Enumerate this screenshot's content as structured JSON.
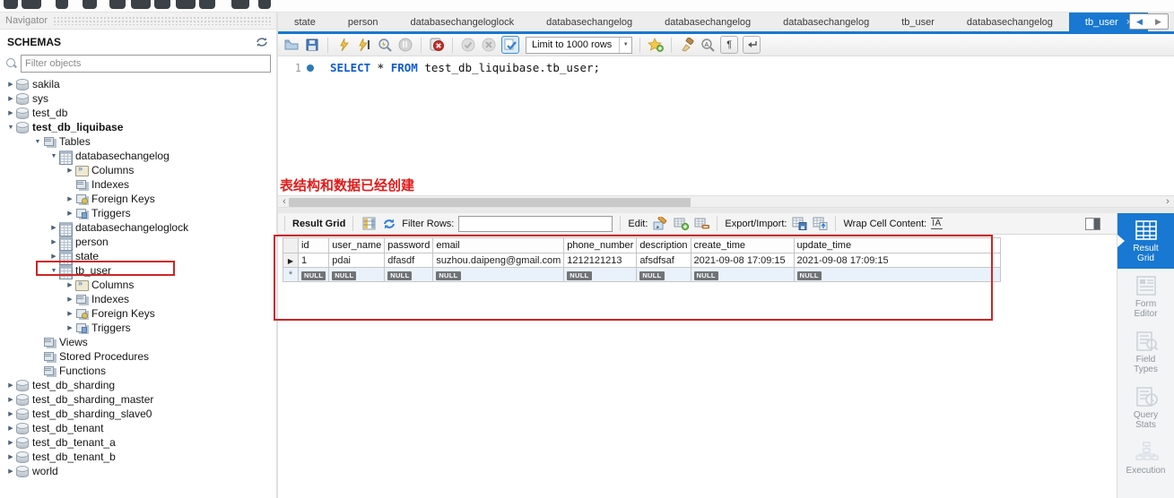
{
  "glyphs": {
    "arrow_right": "▶",
    "arrow_down": "▼",
    "close": "×",
    "caret_down": "▼",
    "scroll_left": "‹",
    "scroll_right": "›",
    "nav_left": "◀",
    "nav_right": "▶",
    "pilcrow": "¶",
    "row_current": "▶",
    "row_new": "*",
    "wrap_cell_icon_text": "ĪA"
  },
  "colors": {
    "accent_blue": "#1878d2",
    "annotation_red": "#e31a1a",
    "null_badge_gray": "#707478",
    "red_annotation_box": "#cf2525"
  },
  "navigator": {
    "title": "Navigator",
    "schemas_header": "SCHEMAS",
    "filter_placeholder": "Filter objects",
    "icons": [
      "refresh-icon",
      "search-icon"
    ],
    "tree": [
      {
        "label": "sakila",
        "icon": "schema-db",
        "arrow": "right",
        "indent": 0
      },
      {
        "label": "sys",
        "icon": "schema-db",
        "arrow": "right",
        "indent": 0
      },
      {
        "label": "test_db",
        "icon": "schema-db",
        "arrow": "right",
        "indent": 0
      },
      {
        "label": "test_db_liquibase",
        "icon": "schema-db",
        "arrow": "down",
        "indent": 0,
        "bold": true
      },
      {
        "label": "Tables",
        "icon": "tables-folder",
        "arrow": "down",
        "indent": 1
      },
      {
        "label": "databasechangelog",
        "icon": "table",
        "arrow": "down",
        "indent": 2
      },
      {
        "label": "Columns",
        "icon": "columns-folder",
        "arrow": "right",
        "indent": 3
      },
      {
        "label": "Indexes",
        "icon": "indexes-folder",
        "arrow": "none",
        "indent": 3
      },
      {
        "label": "Foreign Keys",
        "icon": "foreign-keys-folder",
        "arrow": "right",
        "indent": 3
      },
      {
        "label": "Triggers",
        "icon": "triggers-folder",
        "arrow": "right",
        "indent": 3
      },
      {
        "label": "databasechangeloglock",
        "icon": "table",
        "arrow": "right",
        "indent": 2
      },
      {
        "label": "person",
        "icon": "table",
        "arrow": "right",
        "indent": 2
      },
      {
        "label": "state",
        "icon": "table",
        "arrow": "right",
        "indent": 2
      },
      {
        "label": "tb_user",
        "icon": "table",
        "arrow": "down",
        "indent": 2,
        "highlighted": true
      },
      {
        "label": "Columns",
        "icon": "columns-folder",
        "arrow": "right",
        "indent": 3
      },
      {
        "label": "Indexes",
        "icon": "indexes-folder",
        "arrow": "right",
        "indent": 3
      },
      {
        "label": "Foreign Keys",
        "icon": "foreign-keys-folder",
        "arrow": "right",
        "indent": 3
      },
      {
        "label": "Triggers",
        "icon": "triggers-folder",
        "arrow": "right",
        "indent": 3
      },
      {
        "label": "Views",
        "icon": "views-folder",
        "arrow": "none",
        "indent": 1
      },
      {
        "label": "Stored Procedures",
        "icon": "stored-procedures-folder",
        "arrow": "none",
        "indent": 1
      },
      {
        "label": "Functions",
        "icon": "functions-folder",
        "arrow": "none",
        "indent": 1
      },
      {
        "label": "test_db_sharding",
        "icon": "schema-db",
        "arrow": "right",
        "indent": 0
      },
      {
        "label": "test_db_sharding_master",
        "icon": "schema-db",
        "arrow": "right",
        "indent": 0
      },
      {
        "label": "test_db_sharding_slave0",
        "icon": "schema-db",
        "arrow": "right",
        "indent": 0
      },
      {
        "label": "test_db_tenant",
        "icon": "schema-db",
        "arrow": "right",
        "indent": 0
      },
      {
        "label": "test_db_tenant_a",
        "icon": "schema-db",
        "arrow": "right",
        "indent": 0
      },
      {
        "label": "test_db_tenant_b",
        "icon": "schema-db",
        "arrow": "right",
        "indent": 0
      },
      {
        "label": "world",
        "icon": "schema-db",
        "arrow": "right",
        "indent": 0
      }
    ]
  },
  "tabs": [
    {
      "label": "state",
      "active": false
    },
    {
      "label": "person",
      "active": false
    },
    {
      "label": "databasechangeloglock",
      "active": false
    },
    {
      "label": "databasechangelog",
      "active": false
    },
    {
      "label": "databasechangelog",
      "active": false
    },
    {
      "label": "databasechangelog",
      "active": false
    },
    {
      "label": "tb_user",
      "active": false
    },
    {
      "label": "databasechangelog",
      "active": false
    },
    {
      "label": "tb_user",
      "active": true
    }
  ],
  "sql_toolbar": {
    "icons": [
      "open-file",
      "save",
      "execute",
      "execute-current-statement",
      "explain",
      "stop",
      "toggle-stop-on-error",
      "commit",
      "rollback",
      "toggle-autocommit",
      "save-snippet",
      "beautify",
      "find",
      "show-invisibles",
      "toggle-wrap"
    ],
    "limit_dropdown_value": "Limit to 1000 rows"
  },
  "editor": {
    "line_number": "1",
    "sql_keyword_1": "SELECT",
    "sql_star": " * ",
    "sql_keyword_2": "FROM",
    "sql_rest": " test_db_liquibase.tb_user;"
  },
  "annotation": {
    "text": "表结构和数据已经创建"
  },
  "result_toolbar": {
    "title": "Result Grid",
    "filter_label": "Filter Rows:",
    "filter_value": "",
    "edit_label": "Edit:",
    "export_label": "Export/Import:",
    "wrap_label": "Wrap Cell Content:",
    "icons": [
      "grid-columns",
      "refresh",
      "edit-pencil",
      "add-row",
      "delete-row",
      "export-grid",
      "import-grid",
      "wrap-cell",
      "panel-toggle"
    ]
  },
  "result_grid": {
    "columns": [
      "id",
      "user_name",
      "password",
      "email",
      "phone_number",
      "description",
      "create_time",
      "update_time"
    ],
    "rows": [
      [
        "1",
        "pdai",
        "dfasdf",
        "suzhou.daipeng@gmail.com",
        "1212121213",
        "afsdfsaf",
        "2021-09-08 17:09:15",
        "2021-09-08 17:09:15"
      ]
    ],
    "null_placeholder": "NULL"
  },
  "right_sidebar": {
    "items": [
      {
        "label": "Result Grid",
        "active": true
      },
      {
        "label": "Form Editor",
        "active": false
      },
      {
        "label": "Field Types",
        "active": false
      },
      {
        "label": "Query Stats",
        "active": false
      },
      {
        "label": "Execution",
        "active": false
      }
    ]
  }
}
